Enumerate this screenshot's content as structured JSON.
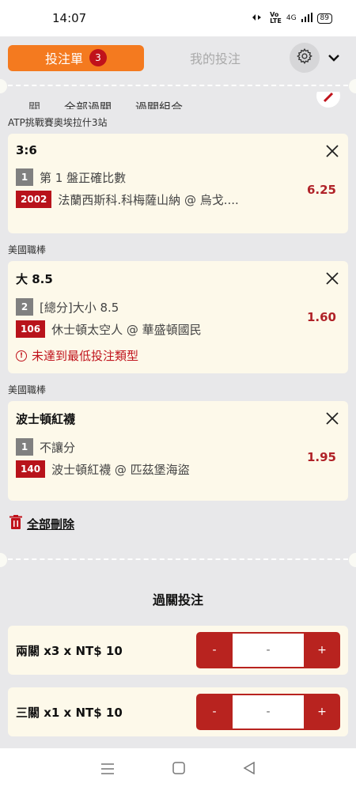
{
  "status": {
    "time": "14:07",
    "network": "4G",
    "battery": "89"
  },
  "header": {
    "betslip_label": "投注單",
    "betslip_count": "3",
    "mybets_label": "我的投注"
  },
  "subtabs": [
    "全部過關",
    "過關組合"
  ],
  "bets": [
    {
      "league": "ATP挑戰賽奧埃拉什3站",
      "title": "3:6",
      "num": "1",
      "market": "第 1 盤正確比數",
      "code": "2002",
      "match": "法蘭西斯科.科梅薩山納 @ 烏戈....",
      "odds": "6.25"
    },
    {
      "league": "美國職棒",
      "title": "大 8.5",
      "num": "2",
      "market": "[總分]大小 8.5",
      "code": "106",
      "match": "休士頓太空人 @ 華盛頓國民",
      "odds": "1.60",
      "warning": "未達到最低投注類型"
    },
    {
      "league": "美國職棒",
      "title": "波士頓紅襪",
      "num": "1",
      "market": "不讓分",
      "code": "140",
      "match": "波士頓紅襪 @ 匹茲堡海盜",
      "odds": "1.95"
    }
  ],
  "delete_all_label": "全部刪除",
  "parlay": {
    "title": "過關投注",
    "rows": [
      {
        "label": "兩關 x3 x NT$ 10",
        "value": "-",
        "minus": "-",
        "plus": "+"
      },
      {
        "label": "三關 x1 x NT$ 10",
        "value": "-",
        "minus": "-",
        "plus": "+"
      }
    ]
  },
  "colors": {
    "accent_orange": "#f47a1f",
    "accent_red": "#b8131b",
    "card_bg": "#fdf9ea"
  }
}
